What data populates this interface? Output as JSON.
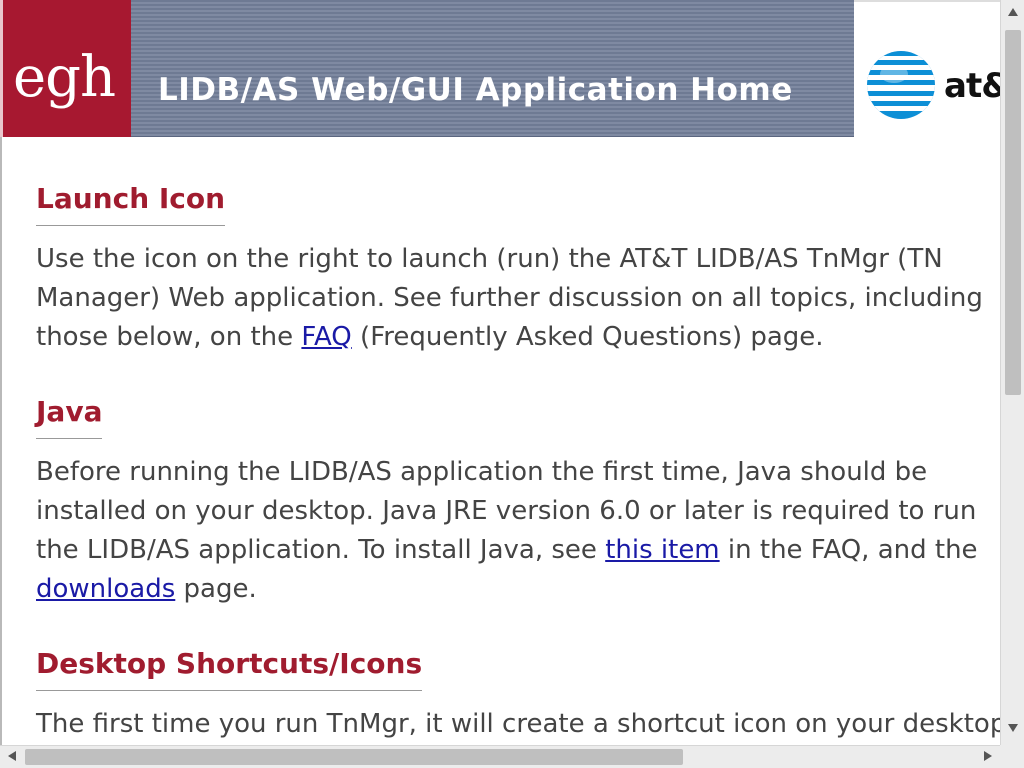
{
  "header": {
    "logo_text": "egh",
    "title": "LIDB/AS Web/GUI Application Home",
    "att_text": "at&t"
  },
  "sections": [
    {
      "heading": "Launch Icon",
      "lines": [
        {
          "text": "Use the icon on the right to launch (run) the AT&T LIDB/AS TnMgr (TN"
        },
        {
          "text": "Manager) Web application. See further discussion on all topics, including"
        },
        {
          "before": "those below, on the ",
          "link": "FAQ",
          "after": " (Frequently Asked Questions) page."
        }
      ]
    },
    {
      "heading": "Java",
      "lines": [
        {
          "text": "Before running the LIDB/AS application the first time, Java should be"
        },
        {
          "text": "installed on your desktop. Java JRE version 6.0 or later is required to run"
        },
        {
          "before": "the LIDB/AS application. To install Java, see ",
          "link": "this item",
          "after": " in the FAQ, and the"
        },
        {
          "before": "",
          "link": "downloads",
          "after": " page."
        }
      ]
    },
    {
      "heading": "Desktop Shortcuts/Icons",
      "lines": [
        {
          "text": "The first time you run TnMgr, it will create a shortcut icon on your desktop"
        }
      ]
    }
  ],
  "colors": {
    "logo_red": "#a71830",
    "heading_red": "#a01c2f",
    "banner_slate": "#7581a0",
    "link_blue": "#1a1aa6"
  }
}
